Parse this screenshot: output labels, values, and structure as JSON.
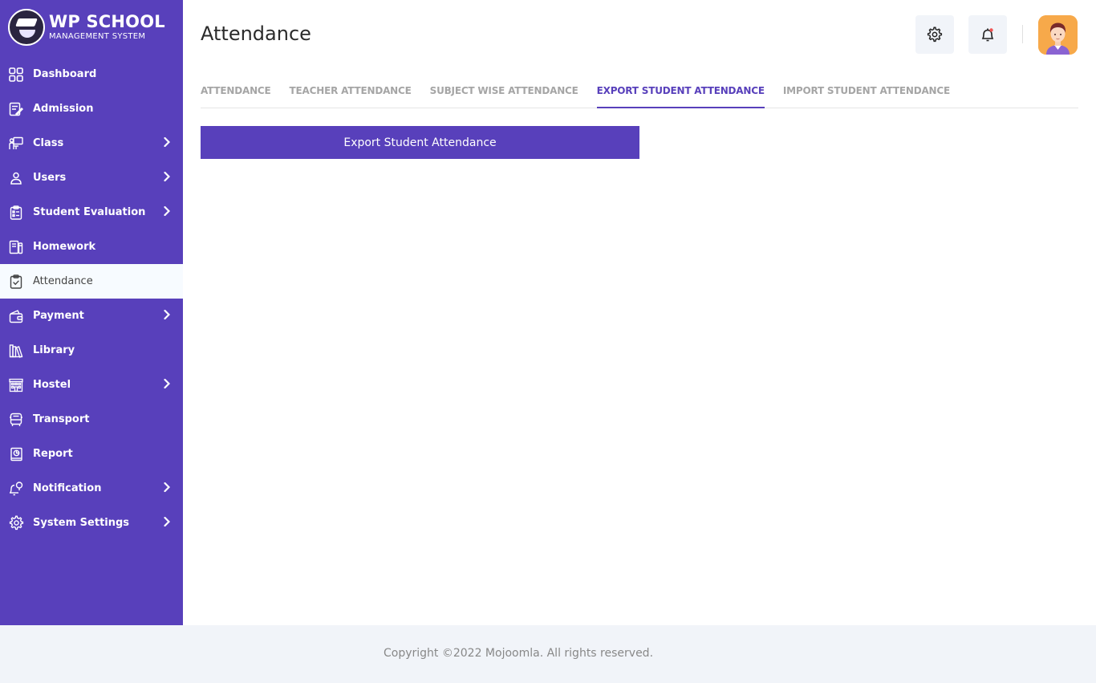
{
  "app": {
    "logo_title": "WP SCHOOL",
    "logo_subtitle": "MANAGEMENT SYSTEM"
  },
  "colors": {
    "primary": "#5840bb",
    "active_bg": "#f7fbff",
    "header_btn_bg": "#f1f4f9",
    "footer_bg": "#f1f4f9",
    "notification_dot": "#f05454",
    "avatar_bg": "#f7a94a"
  },
  "sidebar": {
    "items": [
      {
        "label": "Dashboard",
        "icon": "grid-icon",
        "has_submenu": false,
        "active": false
      },
      {
        "label": "Admission",
        "icon": "edit-document-icon",
        "has_submenu": false,
        "active": false
      },
      {
        "label": "Class",
        "icon": "classroom-icon",
        "has_submenu": true,
        "active": false
      },
      {
        "label": "Users",
        "icon": "user-icon",
        "has_submenu": true,
        "active": false
      },
      {
        "label": "Student Evaluation",
        "icon": "clipboard-list-icon",
        "has_submenu": true,
        "active": false
      },
      {
        "label": "Homework",
        "icon": "homework-book-icon",
        "has_submenu": false,
        "active": false
      },
      {
        "label": "Attendance",
        "icon": "clipboard-check-icon",
        "has_submenu": false,
        "active": true
      },
      {
        "label": "Payment",
        "icon": "wallet-icon",
        "has_submenu": true,
        "active": false
      },
      {
        "label": "Library",
        "icon": "books-icon",
        "has_submenu": false,
        "active": false
      },
      {
        "label": "Hostel",
        "icon": "building-icon",
        "has_submenu": true,
        "active": false
      },
      {
        "label": "Transport",
        "icon": "bus-icon",
        "has_submenu": false,
        "active": false
      },
      {
        "label": "Report",
        "icon": "report-icon",
        "has_submenu": false,
        "active": false
      },
      {
        "label": "Notification",
        "icon": "bell-pin-icon",
        "has_submenu": true,
        "active": false
      },
      {
        "label": "System Settings",
        "icon": "gear-icon",
        "has_submenu": true,
        "active": false
      }
    ]
  },
  "header": {
    "title": "Attendance"
  },
  "tabs": [
    {
      "label": "ATTENDANCE",
      "active": false
    },
    {
      "label": "TEACHER ATTENDANCE",
      "active": false
    },
    {
      "label": "SUBJECT WISE ATTENDANCE",
      "active": false
    },
    {
      "label": "EXPORT STUDENT ATTENDANCE",
      "active": true
    },
    {
      "label": "IMPORT STUDENT ATTENDANCE",
      "active": false
    }
  ],
  "main": {
    "export_button_label": "Export Student Attendance"
  },
  "footer": {
    "copyright": "Copyright ©2022 Mojoomla. All rights reserved."
  }
}
